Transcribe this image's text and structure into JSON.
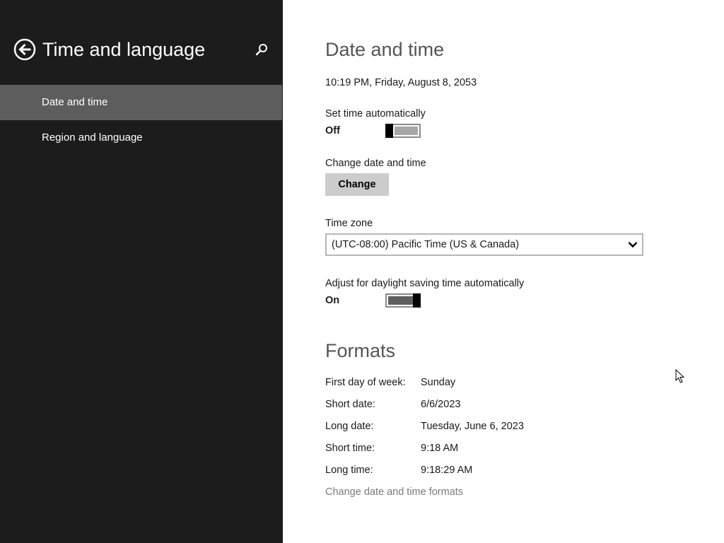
{
  "sidebar": {
    "title": "Time and language",
    "back_icon": "back-arrow-icon",
    "search_icon": "search-icon",
    "items": [
      {
        "label": "Date and time",
        "selected": true
      },
      {
        "label": "Region and language",
        "selected": false
      }
    ]
  },
  "date_time": {
    "heading": "Date and time",
    "current": "10:19 PM, Friday, August 8, 2053",
    "set_auto": {
      "label": "Set time automatically",
      "state": "Off"
    },
    "change": {
      "label": "Change date and time",
      "button": "Change"
    },
    "timezone": {
      "label": "Time zone",
      "value": "(UTC-08:00) Pacific Time (US & Canada)"
    },
    "dst": {
      "label": "Adjust for daylight saving time automatically",
      "state": "On"
    }
  },
  "formats": {
    "heading": "Formats",
    "rows": [
      {
        "label": "First day of week:",
        "value": "Sunday"
      },
      {
        "label": "Short date:",
        "value": "6/6/2023"
      },
      {
        "label": "Long date:",
        "value": "Tuesday, June 6, 2023"
      },
      {
        "label": "Short time:",
        "value": "9:18 AM"
      },
      {
        "label": "Long time:",
        "value": "9:18:29 AM"
      }
    ],
    "change_link": "Change date and time formats"
  },
  "colors": {
    "sidebar_bg": "#1c1c1c",
    "selected_item_bg": "#5d5d5d",
    "button_bg": "#cccccc",
    "toggle_off_fill": "#a6a6a6",
    "toggle_on_fill": "#5e5e5e"
  }
}
